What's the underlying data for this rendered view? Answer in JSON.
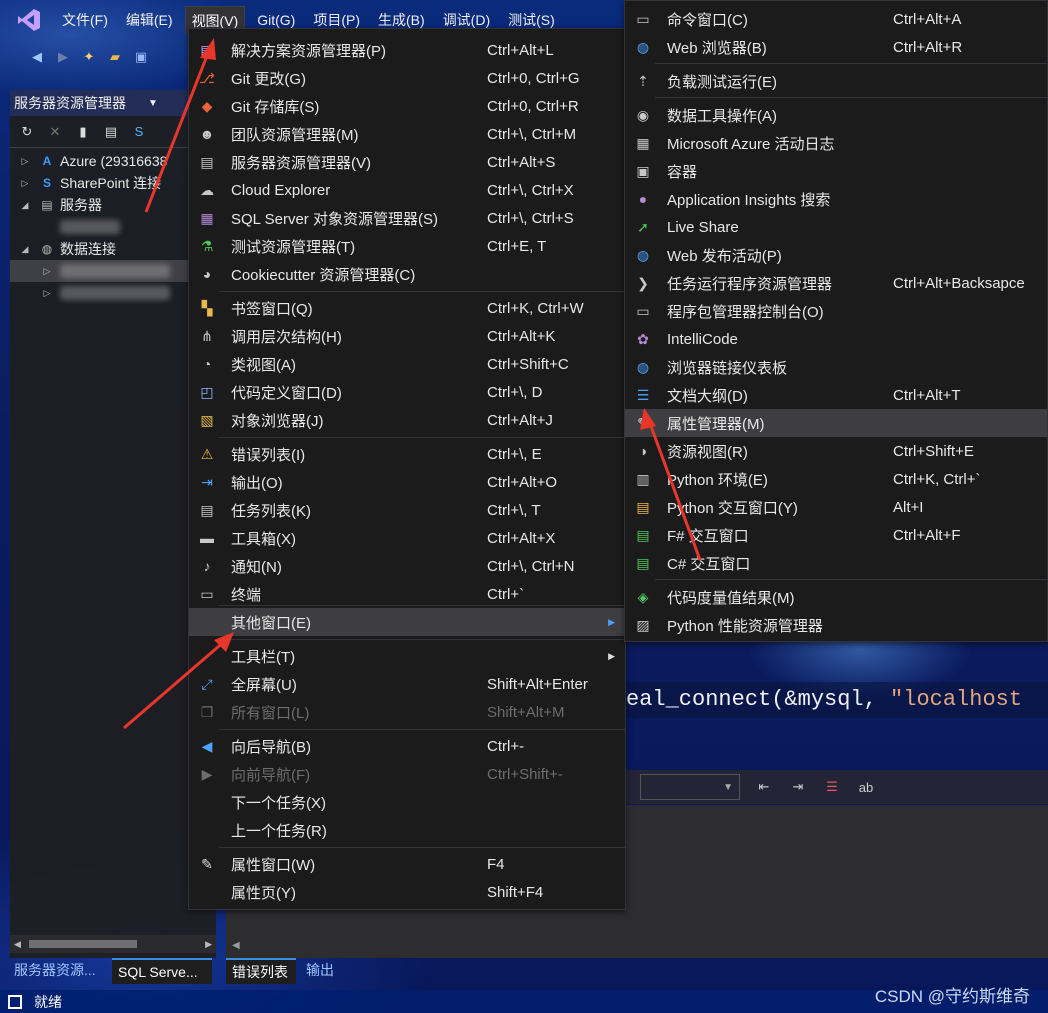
{
  "menubar": {
    "items": [
      "文件(F)",
      "编辑(E)",
      "视图(V)",
      "Git(G)",
      "项目(P)",
      "生成(B)",
      "调试(D)",
      "测试(S)"
    ],
    "active_index": 2
  },
  "server_explorer": {
    "title": "服务器资源管理器",
    "tree": [
      {
        "label": "Azure (29316638",
        "expander": "▷",
        "icon": "azure-icon"
      },
      {
        "label": "SharePoint 连接",
        "expander": "▷",
        "icon": "sharepoint-icon"
      },
      {
        "label": "服务器",
        "expander": "◢",
        "icon": "servers-icon"
      },
      {
        "label": "数据连接",
        "expander": "◢",
        "icon": "data-connections-icon"
      }
    ]
  },
  "view_menu": {
    "items": [
      {
        "label": "解决方案资源管理器(P)",
        "shortcut": "Ctrl+Alt+L",
        "icon": "solution-explorer-icon"
      },
      {
        "label": "Git 更改(G)",
        "shortcut": "Ctrl+0, Ctrl+G",
        "icon": "git-changes-icon"
      },
      {
        "label": "Git 存储库(S)",
        "shortcut": "Ctrl+0, Ctrl+R",
        "icon": "git-repository-icon"
      },
      {
        "label": "团队资源管理器(M)",
        "shortcut": "Ctrl+\\, Ctrl+M",
        "icon": "team-explorer-icon"
      },
      {
        "label": "服务器资源管理器(V)",
        "shortcut": "Ctrl+Alt+S",
        "icon": "server-explorer-icon"
      },
      {
        "label": "Cloud Explorer",
        "shortcut": "Ctrl+\\, Ctrl+X",
        "icon": "cloud-icon"
      },
      {
        "label": "SQL Server 对象资源管理器(S)",
        "shortcut": "Ctrl+\\, Ctrl+S",
        "icon": "sql-server-icon"
      },
      {
        "label": "测试资源管理器(T)",
        "shortcut": "Ctrl+E, T",
        "icon": "test-explorer-icon"
      },
      {
        "label": "Cookiecutter 资源管理器(C)",
        "shortcut": "",
        "icon": "cookiecutter-icon"
      },
      {
        "label": "书签窗口(Q)",
        "shortcut": "Ctrl+K, Ctrl+W",
        "icon": "bookmark-icon"
      },
      {
        "label": "调用层次结构(H)",
        "shortcut": "Ctrl+Alt+K",
        "icon": "call-hierarchy-icon"
      },
      {
        "label": "类视图(A)",
        "shortcut": "Ctrl+Shift+C",
        "icon": "class-view-icon"
      },
      {
        "label": "代码定义窗口(D)",
        "shortcut": "Ctrl+\\, D",
        "icon": "code-definition-icon"
      },
      {
        "label": "对象浏览器(J)",
        "shortcut": "Ctrl+Alt+J",
        "icon": "object-browser-icon"
      },
      {
        "label": "错误列表(I)",
        "shortcut": "Ctrl+\\, E",
        "icon": "error-list-icon"
      },
      {
        "label": "输出(O)",
        "shortcut": "Ctrl+Alt+O",
        "icon": "output-icon"
      },
      {
        "label": "任务列表(K)",
        "shortcut": "Ctrl+\\, T",
        "icon": "task-list-icon"
      },
      {
        "label": "工具箱(X)",
        "shortcut": "Ctrl+Alt+X",
        "icon": "toolbox-icon"
      },
      {
        "label": "通知(N)",
        "shortcut": "Ctrl+\\, Ctrl+N",
        "icon": "notification-bell-icon"
      },
      {
        "label": "终端",
        "shortcut": "Ctrl+`",
        "icon": "terminal-icon"
      },
      {
        "label": "其他窗口(E)",
        "shortcut": "",
        "icon": "",
        "submenu": true
      },
      {
        "label": "工具栏(T)",
        "shortcut": "",
        "icon": "",
        "submenu": true
      },
      {
        "label": "全屏幕(U)",
        "shortcut": "Shift+Alt+Enter",
        "icon": "fullscreen-icon"
      },
      {
        "label": "所有窗口(L)",
        "shortcut": "Shift+Alt+M",
        "icon": "all-windows-icon",
        "disabled": true
      },
      {
        "label": "向后导航(B)",
        "shortcut": "Ctrl+-",
        "icon": "navigate-back-icon"
      },
      {
        "label": "向前导航(F)",
        "shortcut": "Ctrl+Shift+-",
        "icon": "navigate-forward-icon",
        "disabled": true
      },
      {
        "label": "下一个任务(X)",
        "shortcut": "",
        "icon": ""
      },
      {
        "label": "上一个任务(R)",
        "shortcut": "",
        "icon": ""
      },
      {
        "label": "属性窗口(W)",
        "shortcut": "F4",
        "icon": "wrench-icon"
      },
      {
        "label": "属性页(Y)",
        "shortcut": "Shift+F4",
        "icon": ""
      }
    ]
  },
  "other_windows_menu": {
    "items": [
      {
        "label": "命令窗口(C)",
        "shortcut": "Ctrl+Alt+A",
        "icon": "command-window-icon"
      },
      {
        "label": "Web 浏览器(B)",
        "shortcut": "Ctrl+Alt+R",
        "icon": "web-browser-icon"
      },
      {
        "label": "负载测试运行(E)",
        "shortcut": "",
        "icon": "load-test-icon"
      },
      {
        "label": "数据工具操作(A)",
        "shortcut": "",
        "icon": "data-tools-icon"
      },
      {
        "label": "Microsoft Azure 活动日志",
        "shortcut": "",
        "icon": "azure-activity-log-icon"
      },
      {
        "label": "容器",
        "shortcut": "",
        "icon": "container-icon"
      },
      {
        "label": "Application Insights 搜索",
        "shortcut": "",
        "icon": "application-insights-icon"
      },
      {
        "label": "Live Share",
        "shortcut": "",
        "icon": "live-share-icon"
      },
      {
        "label": "Web 发布活动(P)",
        "shortcut": "",
        "icon": "web-publish-icon"
      },
      {
        "label": "任务运行程序资源管理器",
        "shortcut": "Ctrl+Alt+Backsapce",
        "icon": "task-runner-icon"
      },
      {
        "label": "程序包管理器控制台(O)",
        "shortcut": "",
        "icon": "package-manager-console-icon"
      },
      {
        "label": "IntelliCode",
        "shortcut": "",
        "icon": "intellicode-icon"
      },
      {
        "label": "浏览器链接仪表板",
        "shortcut": "",
        "icon": "browser-link-icon"
      },
      {
        "label": "文档大纲(D)",
        "shortcut": "Ctrl+Alt+T",
        "icon": "document-outline-icon"
      },
      {
        "label": "属性管理器(M)",
        "shortcut": "",
        "icon": "wrench-icon",
        "highlighted": true
      },
      {
        "label": "资源视图(R)",
        "shortcut": "Ctrl+Shift+E",
        "icon": "resource-view-icon"
      },
      {
        "label": "Python 环境(E)",
        "shortcut": "Ctrl+K, Ctrl+`",
        "icon": "python-environment-icon"
      },
      {
        "label": "Python 交互窗口(Y)",
        "shortcut": "Alt+I",
        "icon": "python-interactive-icon"
      },
      {
        "label": "F# 交互窗口",
        "shortcut": "Ctrl+Alt+F",
        "icon": "fsharp-interactive-icon"
      },
      {
        "label": "C# 交互窗口",
        "shortcut": "",
        "icon": "csharp-interactive-icon"
      },
      {
        "label": "代码度量值结果(M)",
        "shortcut": "",
        "icon": "code-metrics-icon"
      },
      {
        "label": "Python 性能资源管理器",
        "shortcut": "",
        "icon": "python-performance-icon"
      }
    ]
  },
  "editor": {
    "code_prefix": "eal_connect(&mysql, ",
    "code_string": "\"localhost"
  },
  "bottom_tabs": {
    "left": [
      "服务器资源...",
      "SQL Serve..."
    ],
    "center": [
      "错误列表",
      "输出"
    ]
  },
  "status": {
    "text": "就绪"
  },
  "watermark": "CSDN @守约斯维奇",
  "colors": {
    "accent": "#3a8dde",
    "menu_bg": "#1b1b1c",
    "highlight": "#3e3e40",
    "annotation_arrow": "#e8362b"
  }
}
